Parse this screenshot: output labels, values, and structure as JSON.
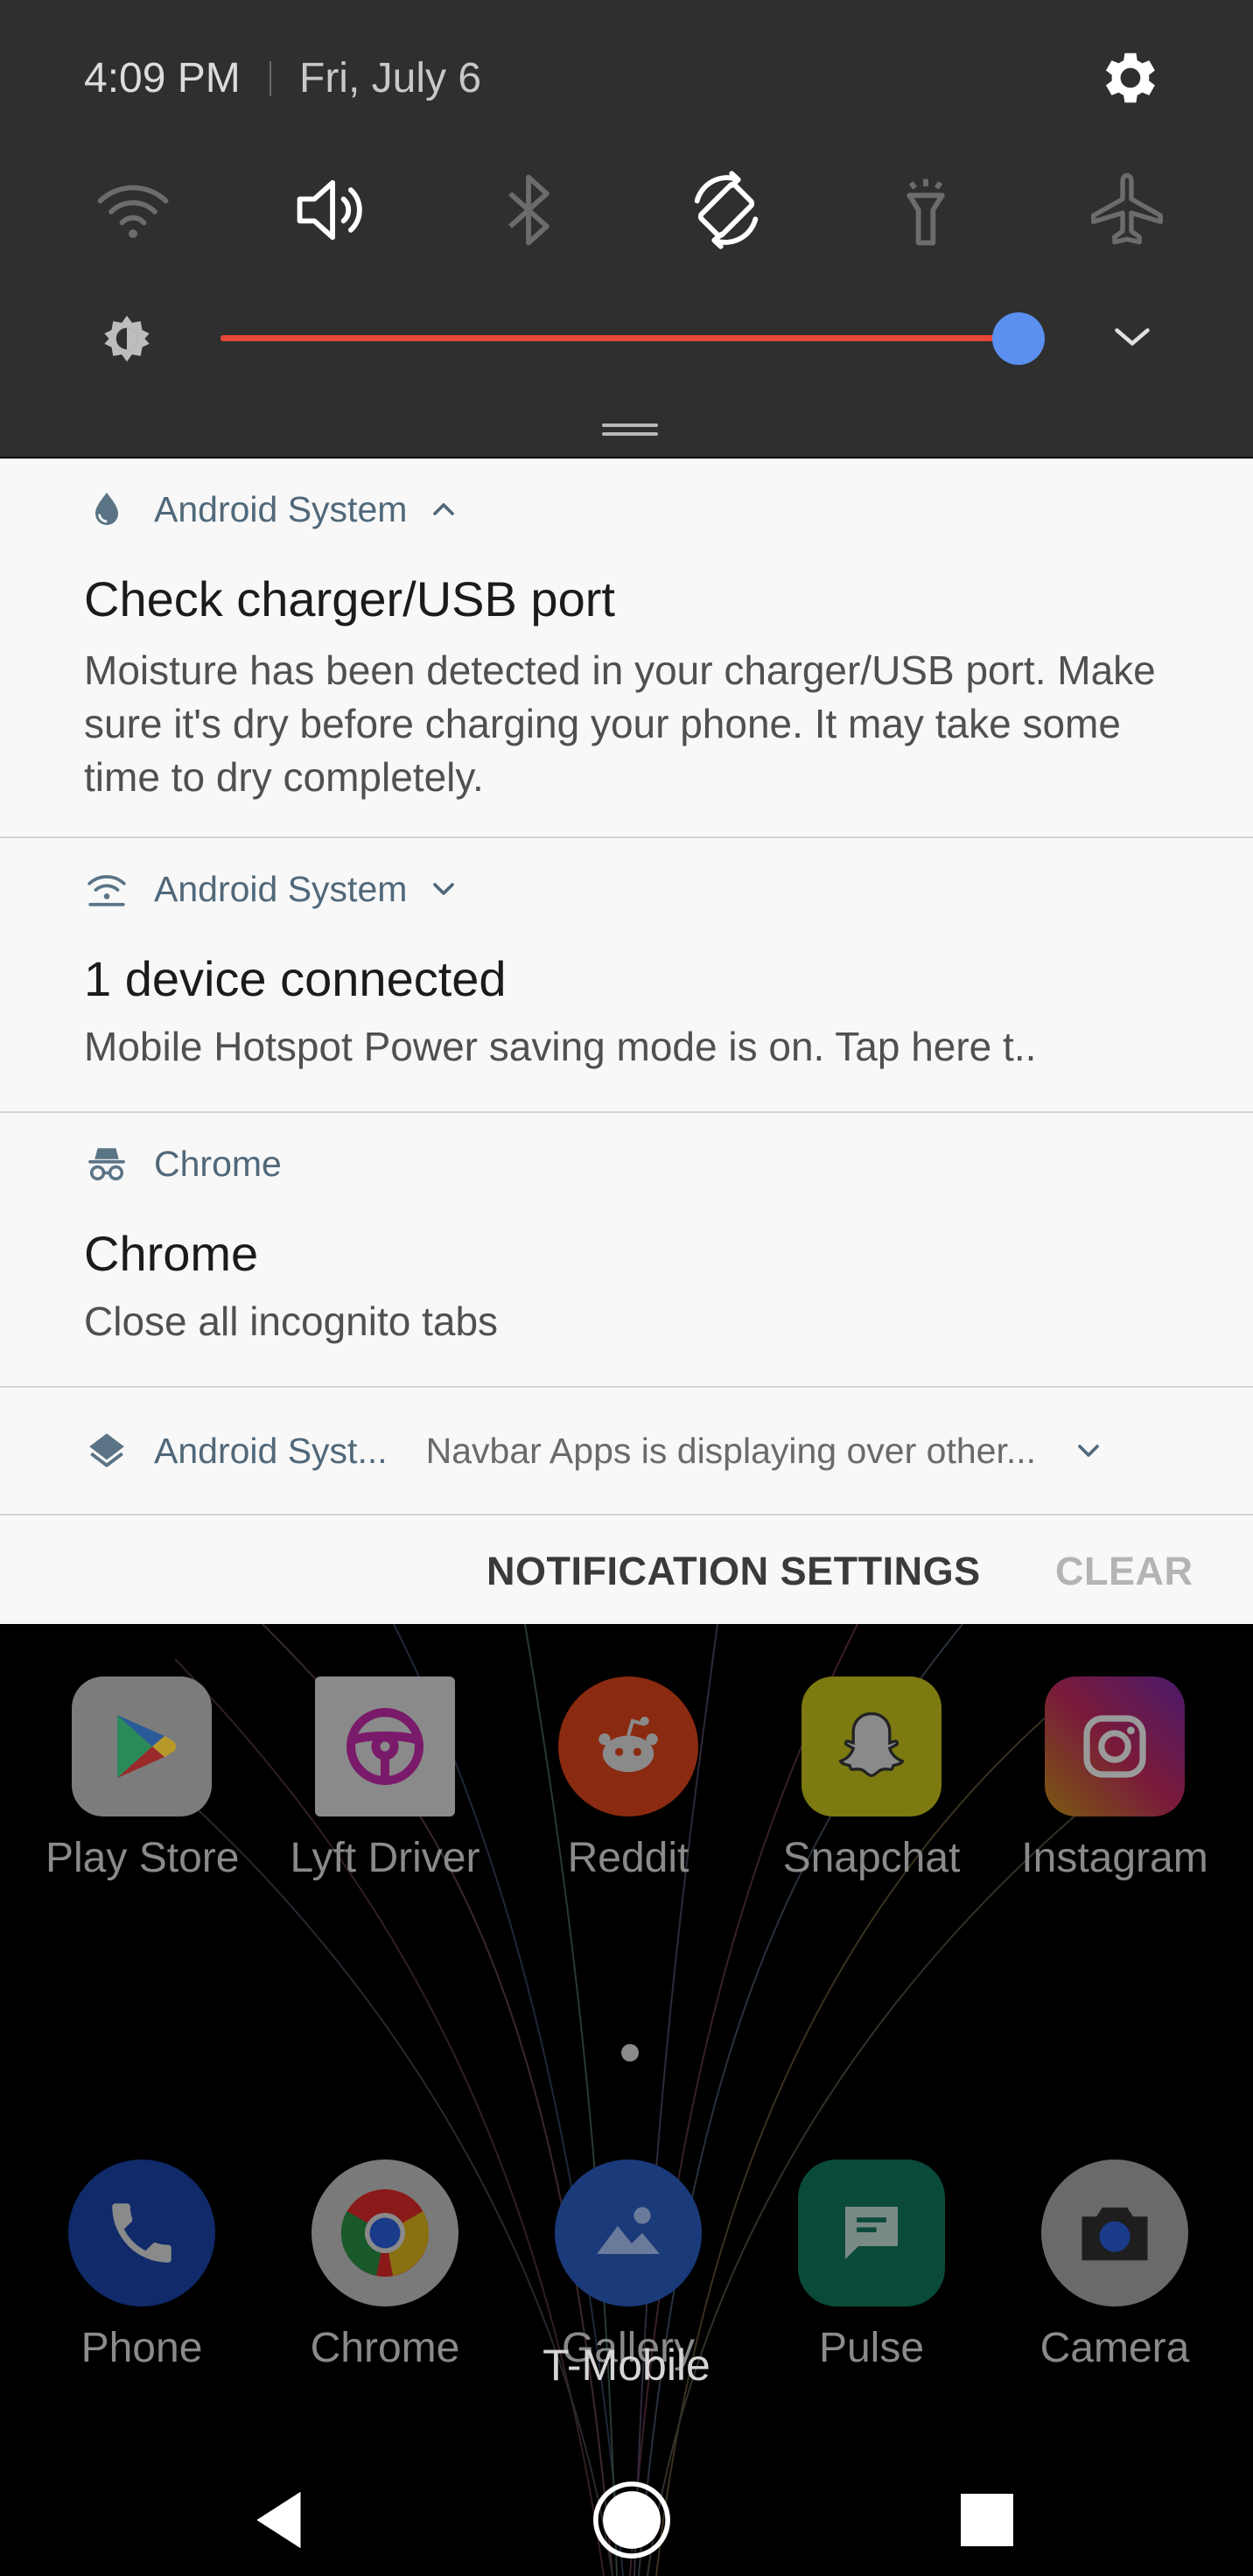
{
  "status": {
    "time": "4:09 PM",
    "date": "Fri, July 6"
  },
  "quick_settings": {
    "tiles": [
      {
        "name": "wifi",
        "icon": "wifi-icon",
        "active": false
      },
      {
        "name": "sound",
        "icon": "volume-icon",
        "active": true
      },
      {
        "name": "bluetooth",
        "icon": "bluetooth-icon",
        "active": false
      },
      {
        "name": "auto-rotate",
        "icon": "rotate-icon",
        "active": true
      },
      {
        "name": "flashlight",
        "icon": "flashlight-icon",
        "active": false
      },
      {
        "name": "airplane",
        "icon": "airplane-icon",
        "active": false
      }
    ],
    "brightness_level": 1.0,
    "colors": {
      "slider_track": "#e5483a",
      "slider_thumb": "#5b8ff0",
      "panel": "#2f2f2f"
    }
  },
  "notifications": [
    {
      "app": "Android System",
      "icon": "water-drop-icon",
      "title": "Check charger/USB port",
      "body": "Moisture has been detected in your charger/USB port. Make sure it's dry before charging your phone. It may take some time to dry completely."
    },
    {
      "app": "Android System",
      "icon": "hotspot-icon",
      "title": "1 device connected",
      "body": "Mobile Hotspot Power saving mode is on. Tap here t.."
    },
    {
      "app": "Chrome",
      "icon": "incognito-icon",
      "title": "Chrome",
      "body": "Close all incognito tabs"
    },
    {
      "app": "Android Syst...",
      "icon": "layers-icon",
      "summary": "Navbar Apps is displaying over other..."
    }
  ],
  "footer": {
    "settings_label": "NOTIFICATION SETTINGS",
    "clear_label": "CLEAR"
  },
  "home": {
    "apps_row": [
      {
        "label": "Play Store",
        "icon": "play-store-icon"
      },
      {
        "label": "Lyft Driver",
        "icon": "lyft-driver-icon"
      },
      {
        "label": "Reddit",
        "icon": "reddit-icon"
      },
      {
        "label": "Snapchat",
        "icon": "snapchat-icon"
      },
      {
        "label": "Instagram",
        "icon": "instagram-icon"
      }
    ],
    "dock": [
      {
        "label": "Phone",
        "icon": "phone-icon"
      },
      {
        "label": "Chrome",
        "icon": "chrome-icon"
      },
      {
        "label": "Gallery",
        "icon": "gallery-icon"
      },
      {
        "label": "Pulse",
        "icon": "pulse-icon"
      },
      {
        "label": "Camera",
        "icon": "camera-icon"
      }
    ],
    "carrier": "T-Mobile"
  }
}
